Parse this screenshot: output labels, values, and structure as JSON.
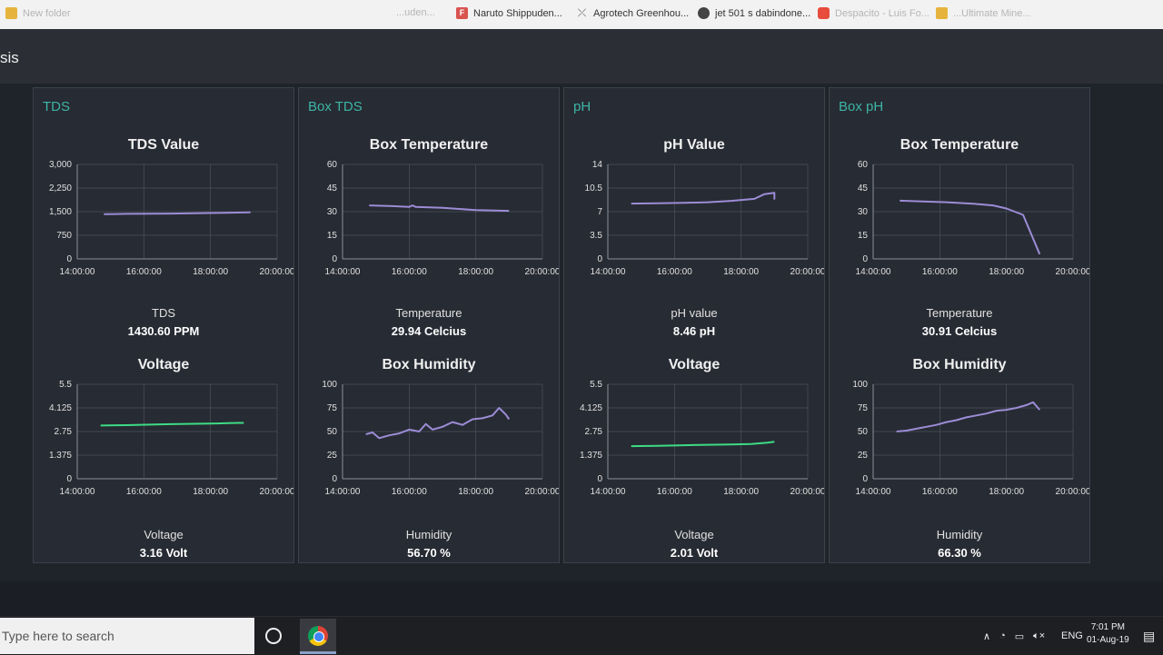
{
  "bookmarks": [
    {
      "label": "New folder",
      "icon": "folder-icon",
      "faded": true
    },
    {
      "label": "...uden...",
      "icon": "",
      "faded": true
    },
    {
      "label": "Naruto Shippuden...",
      "icon": "f-app-icon",
      "faded": false
    },
    {
      "label": "Agrotech Greenhou...",
      "icon": "sheet-icon",
      "faded": false
    },
    {
      "label": "jet 501 s dabindone...",
      "icon": "globe-icon",
      "faded": false
    },
    {
      "label": "Despacito - Luis Fo...",
      "icon": "youtube-icon",
      "faded": true
    },
    {
      "label": "...Ultimate Mine...",
      "icon": "folder-icon",
      "faded": true
    }
  ],
  "header": {
    "title": "sis"
  },
  "colors": {
    "accent": "#3cb5a6",
    "series_purple": "#9c8cd6",
    "series_green": "#3ddc84",
    "grid": "#4b525c"
  },
  "groups": [
    {
      "title": "TDS",
      "top_chart": {
        "title": "TDS Value",
        "chart_data": {
          "type": "line",
          "x_ticks": [
            "14:00:00",
            "16:00:00",
            "18:00:00",
            "20:00:00"
          ],
          "y_ticks": [
            "3,000",
            "2,250",
            "1,500",
            "750",
            "0"
          ],
          "ylim": [
            0,
            3000
          ],
          "color": "#9c8cd6",
          "points": [
            [
              14.8,
              1420
            ],
            [
              15.5,
              1430
            ],
            [
              16.2,
              1435
            ],
            [
              16.8,
              1440
            ],
            [
              17.5,
              1450
            ],
            [
              18.2,
              1460
            ],
            [
              18.8,
              1470
            ],
            [
              19.2,
              1480
            ]
          ]
        }
      },
      "top_readout": {
        "label": "TDS",
        "value": "1430.60 PPM"
      },
      "bottom_chart": {
        "title": "Voltage",
        "chart_data": {
          "type": "line",
          "x_ticks": [
            "14:00:00",
            "16:00:00",
            "18:00:00",
            "20:00:00"
          ],
          "y_ticks": [
            "5.5",
            "4.125",
            "2.75",
            "1.375",
            "0"
          ],
          "ylim": [
            0,
            5.5
          ],
          "color": "#3ddc84",
          "points": [
            [
              14.7,
              3.1
            ],
            [
              15.5,
              3.12
            ],
            [
              16.2,
              3.15
            ],
            [
              16.8,
              3.18
            ],
            [
              17.5,
              3.2
            ],
            [
              18.2,
              3.22
            ],
            [
              18.8,
              3.25
            ],
            [
              19.0,
              3.25
            ]
          ]
        }
      },
      "bottom_readout": {
        "label": "Voltage",
        "value": "3.16 Volt"
      }
    },
    {
      "title": "Box TDS",
      "top_chart": {
        "title": "Box Temperature",
        "chart_data": {
          "type": "line",
          "x_ticks": [
            "14:00:00",
            "16:00:00",
            "18:00:00",
            "20:00:00"
          ],
          "y_ticks": [
            "60",
            "45",
            "30",
            "15",
            "0"
          ],
          "ylim": [
            0,
            60
          ],
          "color": "#9c8cd6",
          "points": [
            [
              14.8,
              34
            ],
            [
              15.5,
              33.5
            ],
            [
              16.0,
              33
            ],
            [
              16.1,
              34
            ],
            [
              16.2,
              33
            ],
            [
              17.0,
              32.5
            ],
            [
              18.0,
              31
            ],
            [
              19.0,
              30.5
            ]
          ]
        }
      },
      "top_readout": {
        "label": "Temperature",
        "value": "29.94 Celcius"
      },
      "bottom_chart": {
        "title": "Box Humidity",
        "chart_data": {
          "type": "line",
          "x_ticks": [
            "14:00:00",
            "16:00:00",
            "18:00:00",
            "20:00:00"
          ],
          "y_ticks": [
            "100",
            "75",
            "50",
            "25",
            "0"
          ],
          "ylim": [
            0,
            100
          ],
          "color": "#9c8cd6",
          "points": [
            [
              14.7,
              47
            ],
            [
              14.9,
              49
            ],
            [
              15.1,
              43
            ],
            [
              15.4,
              46
            ],
            [
              15.7,
              48
            ],
            [
              16.0,
              52
            ],
            [
              16.3,
              50
            ],
            [
              16.5,
              58
            ],
            [
              16.7,
              52
            ],
            [
              17.0,
              55
            ],
            [
              17.3,
              60
            ],
            [
              17.6,
              57
            ],
            [
              17.9,
              63
            ],
            [
              18.2,
              64
            ],
            [
              18.5,
              67
            ],
            [
              18.7,
              75
            ],
            [
              18.9,
              68
            ],
            [
              19.0,
              63
            ]
          ]
        }
      },
      "bottom_readout": {
        "label": "Humidity",
        "value": "56.70 %"
      }
    },
    {
      "title": "pH",
      "top_chart": {
        "title": "pH Value",
        "chart_data": {
          "type": "line",
          "x_ticks": [
            "14:00:00",
            "16:00:00",
            "18:00:00",
            "20:00:00"
          ],
          "y_ticks": [
            "14",
            "10.5",
            "7",
            "3.5",
            "0"
          ],
          "ylim": [
            0,
            14
          ],
          "color": "#9c8cd6",
          "points": [
            [
              14.7,
              8.2
            ],
            [
              15.5,
              8.25
            ],
            [
              16.3,
              8.3
            ],
            [
              17.0,
              8.4
            ],
            [
              17.7,
              8.6
            ],
            [
              18.4,
              8.9
            ],
            [
              18.7,
              9.6
            ],
            [
              19.0,
              9.8
            ],
            [
              19.0,
              8.8
            ]
          ]
        }
      },
      "top_readout": {
        "label": "pH value",
        "value": "8.46 pH"
      },
      "bottom_chart": {
        "title": "Voltage",
        "chart_data": {
          "type": "line",
          "x_ticks": [
            "14:00:00",
            "16:00:00",
            "18:00:00",
            "20:00:00"
          ],
          "y_ticks": [
            "5.5",
            "4.125",
            "2.75",
            "1.375",
            "0"
          ],
          "ylim": [
            0,
            5.5
          ],
          "color": "#3ddc84",
          "points": [
            [
              14.7,
              1.9
            ],
            [
              15.5,
              1.92
            ],
            [
              16.3,
              1.95
            ],
            [
              17.0,
              1.98
            ],
            [
              17.7,
              2.0
            ],
            [
              18.3,
              2.02
            ],
            [
              18.8,
              2.1
            ],
            [
              19.0,
              2.15
            ]
          ]
        }
      },
      "bottom_readout": {
        "label": "Voltage",
        "value": "2.01 Volt"
      }
    },
    {
      "title": "Box pH",
      "top_chart": {
        "title": "Box Temperature",
        "chart_data": {
          "type": "line",
          "x_ticks": [
            "14:00:00",
            "16:00:00",
            "18:00:00",
            "20:00:00"
          ],
          "y_ticks": [
            "60",
            "45",
            "30",
            "15",
            "0"
          ],
          "ylim": [
            0,
            60
          ],
          "color": "#9c8cd6",
          "points": [
            [
              14.8,
              37
            ],
            [
              15.5,
              36.5
            ],
            [
              16.2,
              36
            ],
            [
              17.0,
              35
            ],
            [
              17.6,
              34
            ],
            [
              18.0,
              32
            ],
            [
              18.5,
              28
            ],
            [
              19.0,
              3
            ]
          ]
        }
      },
      "top_readout": {
        "label": "Temperature",
        "value": "30.91 Celcius"
      },
      "bottom_chart": {
        "title": "Box Humidity",
        "chart_data": {
          "type": "line",
          "x_ticks": [
            "14:00:00",
            "16:00:00",
            "18:00:00",
            "20:00:00"
          ],
          "y_ticks": [
            "100",
            "75",
            "50",
            "25",
            "0"
          ],
          "ylim": [
            0,
            100
          ],
          "color": "#9c8cd6",
          "points": [
            [
              14.7,
              50
            ],
            [
              15.0,
              51
            ],
            [
              15.3,
              53
            ],
            [
              15.6,
              55
            ],
            [
              15.9,
              57
            ],
            [
              16.2,
              60
            ],
            [
              16.5,
              62
            ],
            [
              16.8,
              65
            ],
            [
              17.1,
              67
            ],
            [
              17.4,
              69
            ],
            [
              17.7,
              72
            ],
            [
              18.0,
              73
            ],
            [
              18.3,
              75
            ],
            [
              18.6,
              78
            ],
            [
              18.8,
              81
            ],
            [
              19.0,
              73
            ]
          ]
        }
      },
      "bottom_readout": {
        "label": "Humidity",
        "value": "66.30 %"
      }
    }
  ],
  "taskbar": {
    "search_placeholder": "Type here to search",
    "language": "ENG",
    "time": "7:01 PM",
    "date": "01-Aug-19"
  }
}
